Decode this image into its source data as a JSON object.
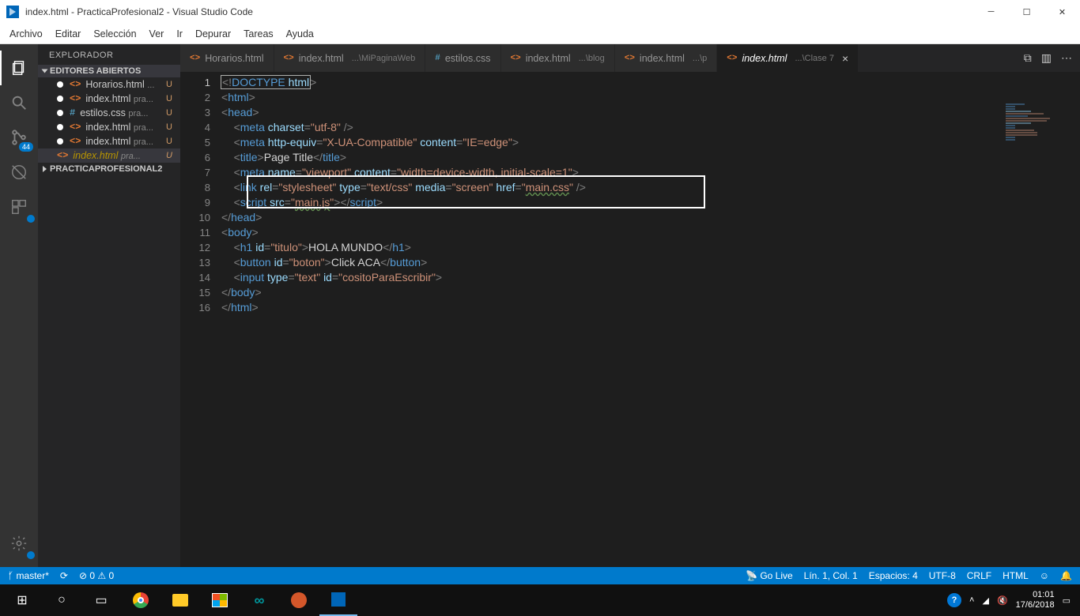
{
  "window": {
    "title": "index.html - PracticaProfesional2 - Visual Studio Code"
  },
  "menu": [
    "Archivo",
    "Editar",
    "Selección",
    "Ver",
    "Ir",
    "Depurar",
    "Tareas",
    "Ayuda"
  ],
  "activity": {
    "badge": "44"
  },
  "sidebar": {
    "title": "EXPLORADOR",
    "section1": "EDITORES ABIERTOS",
    "section2": "PRACTICAPROFESIONAL2",
    "items": [
      {
        "name": "Horarios.html",
        "desc": "...",
        "status": "U",
        "icon": "<>"
      },
      {
        "name": "index.html",
        "desc": "pra...",
        "status": "U",
        "icon": "<>"
      },
      {
        "name": "estilos.css",
        "desc": "pra...",
        "status": "U",
        "icon": "#"
      },
      {
        "name": "index.html",
        "desc": "pra...",
        "status": "U",
        "icon": "<>"
      },
      {
        "name": "index.html",
        "desc": "pra...",
        "status": "U",
        "icon": "<>"
      },
      {
        "name": "index.html",
        "desc": "pra...",
        "status": "U",
        "icon": "<>",
        "ital": true,
        "sel": true
      }
    ]
  },
  "tabs": [
    {
      "icon": "<>",
      "label": "Horarios.html",
      "desc": ""
    },
    {
      "icon": "<>",
      "label": "index.html",
      "desc": "...\\MiPaginaWeb"
    },
    {
      "icon": "#",
      "label": "estilos.css",
      "desc": ""
    },
    {
      "icon": "<>",
      "label": "index.html",
      "desc": "...\\blog"
    },
    {
      "icon": "<>",
      "label": "index.html",
      "desc": "...\\p"
    },
    {
      "icon": "<>",
      "label": "index.html",
      "desc": "...\\Clase 7",
      "active": true,
      "close": true
    }
  ],
  "code": {
    "l1a": "<!",
    "l1b": "DOCTYPE",
    "l1c": " html",
    "l1d": ">",
    "l2": "<html>",
    "l3": "<head>",
    "l4": "    <meta charset=\"utf-8\" />",
    "l5": "    <meta http-equiv=\"X-UA-Compatible\" content=\"IE=edge\">",
    "l6": "    <title>Page Title</title>",
    "l7": "    <meta name=\"viewport\" content=\"width=device-width, initial-scale=1\">",
    "l8": "    <link rel=\"stylesheet\" type=\"text/css\" media=\"screen\" href=\"main.css\" />",
    "l9": "    <script src=\"main.js\"></script>",
    "l10": "</head>",
    "l11": "<body>",
    "l12": "    <h1 id=\"titulo\">HOLA MUNDO</h1>",
    "l13": "    <button id=\"boton\">Click ACA</button>",
    "l14": "    <input type=\"text\" id=\"cositoParaEscribir\">",
    "l15": "</body>",
    "l16": "</html>",
    "hl_href": "main.css",
    "hl_src": "main.js"
  },
  "status": {
    "branch": "master*",
    "errors": "0",
    "warnings": "0",
    "golive": "Go Live",
    "pos": "Lín. 1, Col. 1",
    "spaces": "Espacios: 4",
    "enc": "UTF-8",
    "eol": "CRLF",
    "lang": "HTML"
  },
  "clock": {
    "time": "01:01",
    "date": "17/6/2018"
  }
}
